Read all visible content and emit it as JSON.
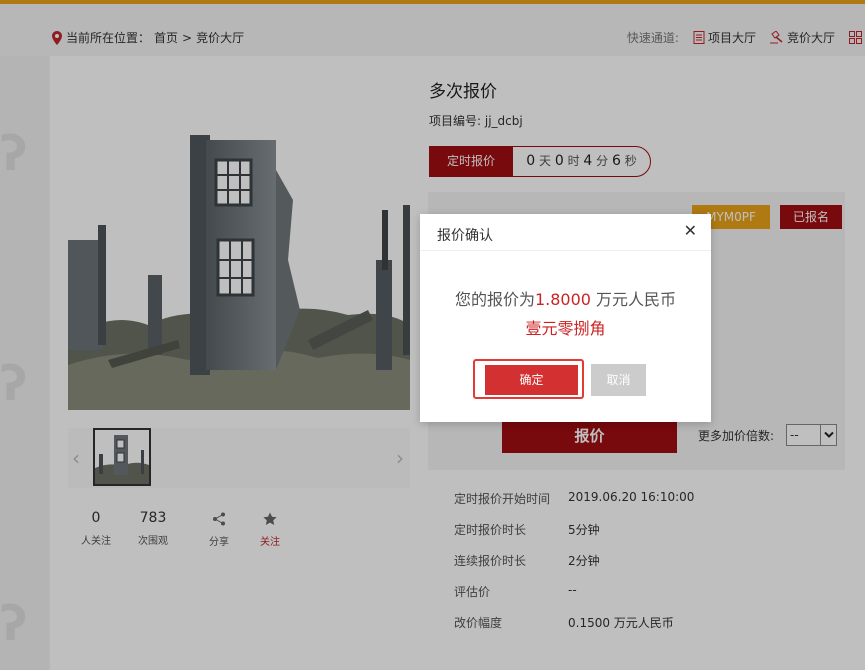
{
  "breadcrumb": {
    "prefix": "当前所在位置：",
    "home": "首页",
    "separator": ">",
    "current": "竞价大厅"
  },
  "quick_links": {
    "label": "快速通道:",
    "items": [
      {
        "label": "项目大厅",
        "icon": "document-list-icon"
      },
      {
        "label": "竞价大厅",
        "icon": "gavel-icon"
      },
      {
        "label": "",
        "icon": "grid-icon"
      }
    ]
  },
  "item": {
    "title": "多次报价",
    "project_no_label": "项目编号:",
    "project_no": "jj_dcbj"
  },
  "timer": {
    "tag": "定时报价",
    "days": "0",
    "days_unit": "天",
    "hours": "0",
    "hours_unit": "时",
    "minutes": "4",
    "minutes_unit": "分",
    "seconds": "6",
    "seconds_unit": "秒"
  },
  "badges": {
    "code": "MYM0PF",
    "status": "已报名"
  },
  "bid": {
    "button": "报价",
    "multiplier_label": "更多加价倍数:",
    "multiplier_value": "--"
  },
  "stats": [
    {
      "num": "0",
      "label": "人关注"
    },
    {
      "num": "783",
      "label": "次围观"
    },
    {
      "num": "",
      "label": "分享",
      "icon": "share-icon"
    },
    {
      "num": "",
      "label": "关注",
      "icon": "star-icon"
    }
  ],
  "info": [
    {
      "key": "定时报价开始时间",
      "value": "2019.06.20 16:10:00"
    },
    {
      "key": "定时报价时长",
      "value": "5分钟"
    },
    {
      "key": "连续报价时长",
      "value": "2分钟"
    },
    {
      "key": "评估价",
      "value": "--"
    },
    {
      "key": "改价幅度",
      "value": "0.1500 万元人民币"
    }
  ],
  "modal": {
    "title": "报价确认",
    "msg_prefix": "您的报价为",
    "amount": "1.8000",
    "msg_suffix": " 万元人民币",
    "amount_words": "壹元零捌角",
    "confirm": "确定",
    "cancel": "取消"
  },
  "colors": {
    "brand_red": "#a00d10",
    "accent_orange": "#e8a317",
    "highlight_red": "#e53935"
  }
}
